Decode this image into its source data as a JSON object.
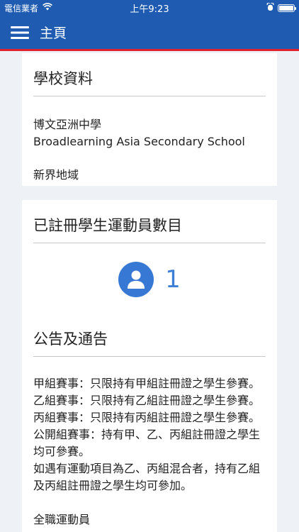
{
  "status_bar": {
    "carrier": "電信業者",
    "time": "上午9:23"
  },
  "nav": {
    "title": "主頁"
  },
  "school_info": {
    "title": "學校資料",
    "name_zh": "博文亞洲中學",
    "name_en": "Broadlearning Asia Secondary School",
    "district": "新界地域"
  },
  "athletes": {
    "title": "已註冊學生運動員數目",
    "count": "1"
  },
  "notices": {
    "title": "公告及通告",
    "lines": [
      "甲組賽事：只限持有甲組註冊證之學生參賽。",
      "乙組賽事：只限持有乙組註冊證之學生參賽。",
      "丙組賽事：只限持有丙組註冊證之學生參賽。",
      "公開組賽事：持有甲、乙、丙組註冊證之學生均可參賽。",
      "如遇有運動項目為乙、丙組混合者，持有乙組及丙組註冊證之學生均可參加。"
    ],
    "footer": "全職運動員"
  },
  "colors": {
    "header": "#1f5cb1",
    "accent_line": "#e0232e",
    "count_blue": "#3d7fd6"
  },
  "icons": {
    "menu": "hamburger-icon",
    "wifi": "wifi-icon",
    "battery": "battery-icon",
    "user": "user-icon"
  }
}
